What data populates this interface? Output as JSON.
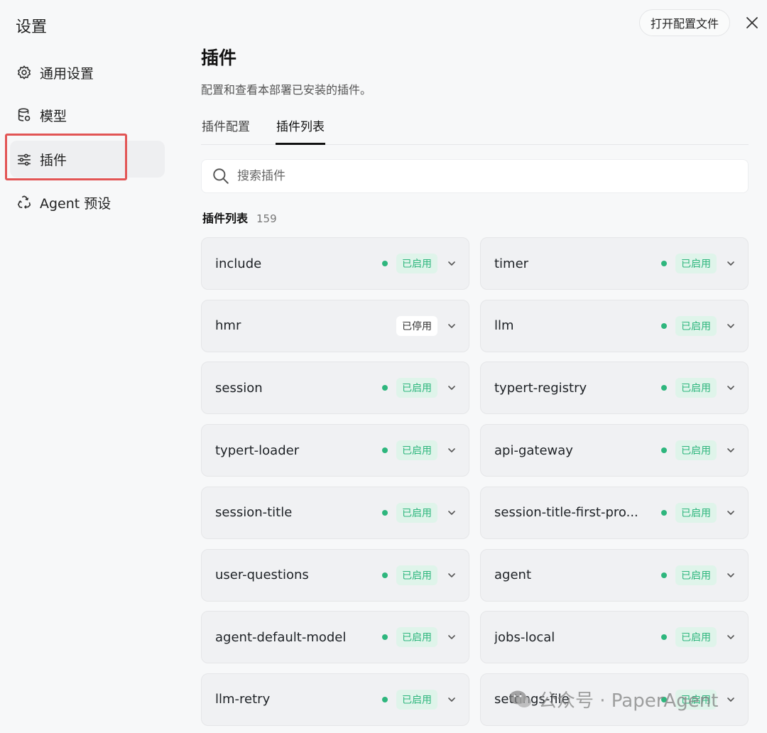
{
  "window": {
    "title": "设置",
    "open_config_label": "打开配置文件"
  },
  "sidebar": {
    "items": [
      {
        "label": "通用设置",
        "icon": "gear-icon"
      },
      {
        "label": "模型",
        "icon": "database-icon"
      },
      {
        "label": "插件",
        "icon": "sliders-icon"
      },
      {
        "label": "Agent 预设",
        "icon": "recycle-icon"
      }
    ],
    "active": "插件"
  },
  "main": {
    "title": "插件",
    "description": "配置和查看本部署已安装的插件。",
    "tabs": [
      {
        "label": "插件配置"
      },
      {
        "label": "插件列表"
      }
    ],
    "active_tab": "插件列表",
    "search": {
      "placeholder": "搜索插件"
    },
    "list": {
      "heading": "插件列表",
      "count": "159"
    },
    "plugins": [
      {
        "name": "include",
        "status": "已启用",
        "enabled": true
      },
      {
        "name": "timer",
        "status": "已启用",
        "enabled": true
      },
      {
        "name": "hmr",
        "status": "已停用",
        "enabled": false
      },
      {
        "name": "llm",
        "status": "已启用",
        "enabled": true
      },
      {
        "name": "session",
        "status": "已启用",
        "enabled": true
      },
      {
        "name": "typert-registry",
        "status": "已启用",
        "enabled": true
      },
      {
        "name": "typert-loader",
        "status": "已启用",
        "enabled": true
      },
      {
        "name": "api-gateway",
        "status": "已启用",
        "enabled": true
      },
      {
        "name": "session-title",
        "status": "已启用",
        "enabled": true
      },
      {
        "name": "session-title-first-pro...",
        "status": "已启用",
        "enabled": true
      },
      {
        "name": "user-questions",
        "status": "已启用",
        "enabled": true
      },
      {
        "name": "agent",
        "status": "已启用",
        "enabled": true
      },
      {
        "name": "agent-default-model",
        "status": "已启用",
        "enabled": true
      },
      {
        "name": "jobs-local",
        "status": "已启用",
        "enabled": true
      },
      {
        "name": "llm-retry",
        "status": "已启用",
        "enabled": true
      },
      {
        "name": "settings-file",
        "status": "已启用",
        "enabled": true
      }
    ]
  },
  "watermark": {
    "text": "公众号 · PaperAgent",
    "icon": "wechat-icon"
  },
  "colors": {
    "enabled_green": "#2eb67d",
    "highlight_red": "#e25555"
  }
}
